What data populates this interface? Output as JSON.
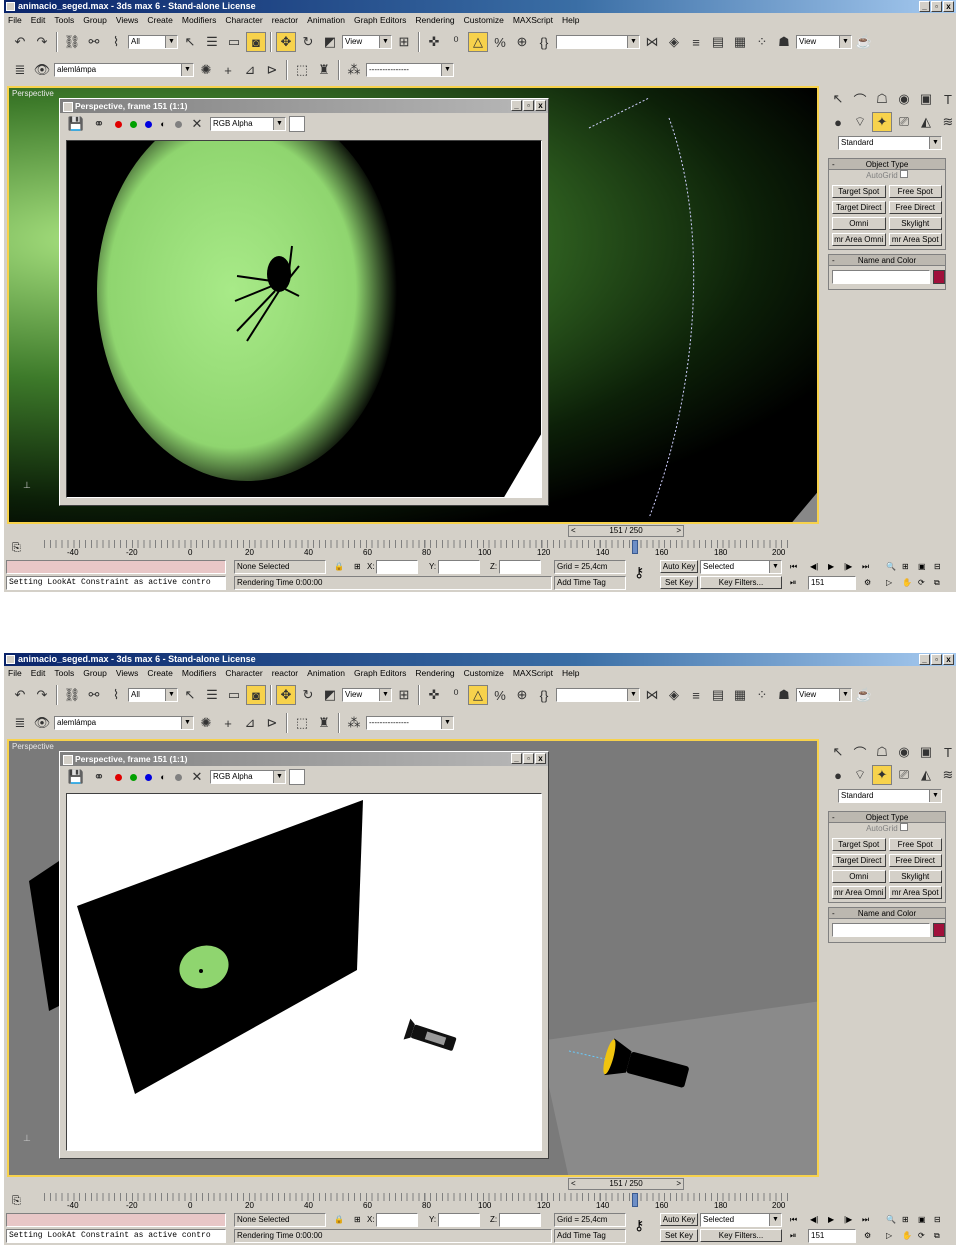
{
  "app": {
    "title": "animacio_seged.max - 3ds max 6 - Stand-alone License",
    "window_controls": [
      "_",
      "▫",
      "x"
    ]
  },
  "menu": [
    "File",
    "Edit",
    "Tools",
    "Group",
    "Views",
    "Create",
    "Modifiers",
    "Character",
    "reactor",
    "Animation",
    "Graph Editors",
    "Rendering",
    "Customize",
    "MAXScript",
    "Help"
  ],
  "toolbar": {
    "selection_filter": "All",
    "ref_coord": "View",
    "named_selection": "",
    "view_dropdown": "View",
    "layer": "alemlámpa",
    "layer_dropdown2": "---------------"
  },
  "viewport": {
    "label": "Perspective"
  },
  "render_window": {
    "title": "Perspective, frame 151 (1:1)",
    "channel": "RGB Alpha",
    "channel_colors": [
      "#e00000",
      "#00a000",
      "#0000e0"
    ]
  },
  "command_panel": {
    "category": "Standard",
    "object_type": {
      "header": "Object Type",
      "autogrid": "AutoGrid",
      "buttons": [
        "Target Spot",
        "Free Spot",
        "Target Direct",
        "Free Direct",
        "Omni",
        "Skylight",
        "mr Area Omni",
        "mr Area Spot"
      ]
    },
    "name_color": {
      "header": "Name and Color",
      "value": "",
      "swatch": "#a0103a"
    }
  },
  "timeline": {
    "frame_display": "151 / 250",
    "ticks": [
      "-40",
      "-20",
      "0",
      "20",
      "40",
      "60",
      "80",
      "100",
      "120",
      "140",
      "160",
      "180",
      "200"
    ]
  },
  "status": {
    "selection": "None Selected",
    "x_label": "X:",
    "y_label": "Y:",
    "z_label": "Z:",
    "grid": "Grid = 25,4cm",
    "auto_key": "Auto Key",
    "auto_key_mode": "Selected",
    "set_key": "Set Key",
    "key_filters": "Key Filters...",
    "frame": "151",
    "prompt": "Setting LookAt Constraint as active contro",
    "rendering_time": "Rendering Time  0:00:00",
    "add_time_tag": "Add Time Tag"
  }
}
